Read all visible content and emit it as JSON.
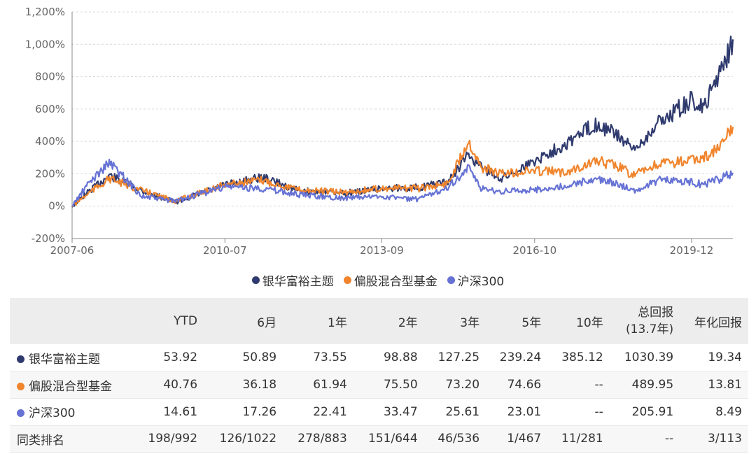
{
  "chart_data": {
    "type": "line",
    "y_ticks": [
      "1,200%",
      "1,000%",
      "800%",
      "600%",
      "400%",
      "200%",
      "0%",
      "-200%"
    ],
    "x_ticks": [
      "2007-06",
      "2010-07",
      "2013-09",
      "2016-10",
      "2019-12"
    ],
    "ylim": [
      -200,
      1200
    ],
    "x_range": [
      "2007-06",
      "2020-10"
    ],
    "grid": true,
    "legend_position": "bottom",
    "series": [
      {
        "name": "银华富裕主题",
        "color": "#2f3a6e",
        "x": [
          "2007-06",
          "2007-10",
          "2008-03",
          "2008-11",
          "2009-07",
          "2010-07",
          "2011-04",
          "2012-01",
          "2012-12",
          "2013-09",
          "2014-06",
          "2015-01",
          "2015-06",
          "2015-09",
          "2016-02",
          "2016-10",
          "2017-05",
          "2018-01",
          "2018-06",
          "2018-10",
          "2019-04",
          "2019-12",
          "2020-03",
          "2020-07",
          "2020-10"
        ],
        "values": [
          0,
          90,
          190,
          95,
          25,
          130,
          180,
          95,
          80,
          110,
          115,
          150,
          320,
          240,
          170,
          280,
          380,
          510,
          440,
          340,
          520,
          650,
          600,
          850,
          1030
        ]
      },
      {
        "name": "偏股混合型基金",
        "color": "#f0852d",
        "x": [
          "2007-06",
          "2007-10",
          "2008-03",
          "2008-11",
          "2009-07",
          "2010-07",
          "2011-04",
          "2012-01",
          "2012-12",
          "2013-09",
          "2014-06",
          "2015-01",
          "2015-06",
          "2015-09",
          "2016-02",
          "2016-10",
          "2017-05",
          "2018-01",
          "2018-06",
          "2018-10",
          "2019-04",
          "2019-12",
          "2020-03",
          "2020-07",
          "2020-10"
        ],
        "values": [
          0,
          80,
          170,
          95,
          30,
          135,
          160,
          100,
          85,
          110,
          110,
          140,
          410,
          240,
          200,
          220,
          210,
          280,
          250,
          190,
          260,
          280,
          300,
          360,
          490
        ]
      },
      {
        "name": "沪深300",
        "color": "#6672d4",
        "x": [
          "2007-06",
          "2007-10",
          "2008-03",
          "2008-11",
          "2009-07",
          "2010-07",
          "2011-04",
          "2012-01",
          "2012-12",
          "2013-09",
          "2014-06",
          "2015-01",
          "2015-06",
          "2015-09",
          "2016-02",
          "2016-10",
          "2017-05",
          "2018-01",
          "2018-06",
          "2018-10",
          "2019-04",
          "2019-12",
          "2020-03",
          "2020-07",
          "2020-10"
        ],
        "values": [
          0,
          140,
          270,
          60,
          30,
          120,
          110,
          70,
          50,
          60,
          40,
          120,
          230,
          110,
          90,
          100,
          120,
          170,
          140,
          90,
          160,
          150,
          130,
          170,
          206
        ]
      }
    ]
  },
  "legend": [
    {
      "label": "银华富裕主题",
      "color": "#2f3a6e"
    },
    {
      "label": "偏股混合型基金",
      "color": "#f0852d"
    },
    {
      "label": "沪深300",
      "color": "#6672d4"
    }
  ],
  "table": {
    "headers": [
      "YTD",
      "6月",
      "1年",
      "2年",
      "3年",
      "5年",
      "10年",
      "总回报",
      "(13.7年)",
      "年化回报"
    ],
    "rows": [
      {
        "name": "银华富裕主题",
        "color": "#2f3a6e",
        "values": [
          "53.92",
          "50.89",
          "73.55",
          "98.88",
          "127.25",
          "239.24",
          "385.12",
          "1030.39",
          "19.34"
        ]
      },
      {
        "name": "偏股混合型基金",
        "color": "#f0852d",
        "values": [
          "40.76",
          "36.18",
          "61.94",
          "75.50",
          "73.20",
          "74.66",
          "--",
          "489.95",
          "13.81"
        ]
      },
      {
        "name": "沪深300",
        "color": "#6672d4",
        "values": [
          "14.61",
          "17.26",
          "22.41",
          "33.47",
          "25.61",
          "23.01",
          "--",
          "205.91",
          "8.49"
        ]
      },
      {
        "name": "同类排名",
        "values": [
          "198/992",
          "126/1022",
          "278/883",
          "151/644",
          "46/536",
          "1/467",
          "11/281",
          "--",
          "3/113"
        ]
      }
    ]
  }
}
